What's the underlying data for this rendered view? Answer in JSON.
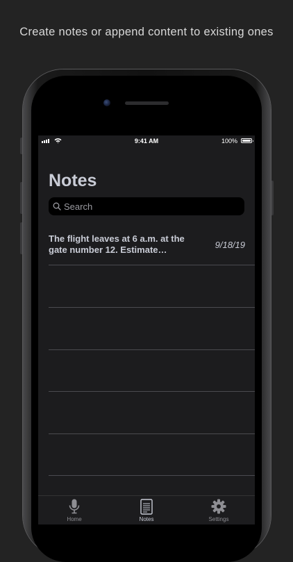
{
  "caption": "Create notes or append content to existing ones",
  "status_bar": {
    "time": "9:41 AM",
    "battery": "100%"
  },
  "screen": {
    "title": "Notes",
    "search": {
      "placeholder": "Search"
    },
    "notes": [
      {
        "text": "The flight leaves at 6 a.m. at the gate number 12. Estimate…",
        "date": "9/18/19"
      }
    ]
  },
  "tabbar": {
    "tabs": [
      {
        "label": "Home",
        "icon": "microphone-icon",
        "active": false
      },
      {
        "label": "Notes",
        "icon": "document-icon",
        "active": true
      },
      {
        "label": "Settings",
        "icon": "gear-icon",
        "active": false
      }
    ]
  },
  "colors": {
    "background": "#232323",
    "screen": "#1c1c1e",
    "text": "#c9ccd6",
    "separator": "#4b4b50"
  }
}
